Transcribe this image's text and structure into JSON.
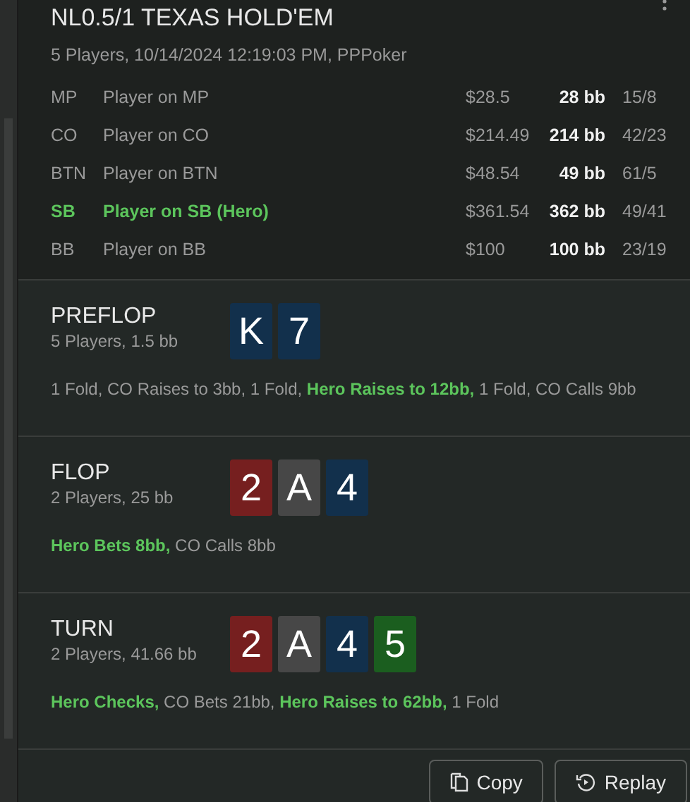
{
  "header": {
    "title": "NL0.5/1 TEXAS HOLD'EM",
    "subtitle": "5 Players, 10/14/2024 12:19:03 PM, PPPoker"
  },
  "players": [
    {
      "position": "MP",
      "name": "Player on MP",
      "stack": "$28.5",
      "bb": "28 bb",
      "stats": "15/8",
      "hero": false
    },
    {
      "position": "CO",
      "name": "Player on CO",
      "stack": "$214.49",
      "bb": "214 bb",
      "stats": "42/23",
      "hero": false
    },
    {
      "position": "BTN",
      "name": "Player on BTN",
      "stack": "$48.54",
      "bb": "49 bb",
      "stats": "61/5",
      "hero": false
    },
    {
      "position": "SB",
      "name": "Player on SB (Hero)",
      "stack": "$361.54",
      "bb": "362 bb",
      "stats": "49/41",
      "hero": true
    },
    {
      "position": "BB",
      "name": "Player on BB",
      "stack": "$100",
      "bb": "100 bb",
      "stats": "23/19",
      "hero": false
    }
  ],
  "streets": [
    {
      "name": "PREFLOP",
      "info": "5 Players, 1.5 bb",
      "cards": [
        {
          "rank": "K",
          "color": "#12304c"
        },
        {
          "rank": "7",
          "color": "#12304c"
        }
      ],
      "actions": "1 Fold, CO Raises to 3bb, 1 Fold, **Hero Raises to 12bb,** 1 Fold, CO Calls 9bb"
    },
    {
      "name": "FLOP",
      "info": "2 Players, 25 bb",
      "cards": [
        {
          "rank": "2",
          "color": "#761f1f"
        },
        {
          "rank": "A",
          "color": "#474747"
        },
        {
          "rank": "4",
          "color": "#12304c"
        }
      ],
      "actions": "**Hero Bets 8bb,** CO Calls 8bb"
    },
    {
      "name": "TURN",
      "info": "2 Players, 41.66 bb",
      "cards": [
        {
          "rank": "2",
          "color": "#761f1f"
        },
        {
          "rank": "A",
          "color": "#474747"
        },
        {
          "rank": "4",
          "color": "#12304c"
        },
        {
          "rank": "5",
          "color": "#1b5e1f"
        }
      ],
      "actions": "**Hero Checks,** CO Bets 21bb, **Hero Raises to 62bb,** 1 Fold"
    }
  ],
  "buttons": [
    {
      "label": "Copy",
      "kind": "copy"
    },
    {
      "label": "Replay",
      "kind": "replay"
    }
  ]
}
